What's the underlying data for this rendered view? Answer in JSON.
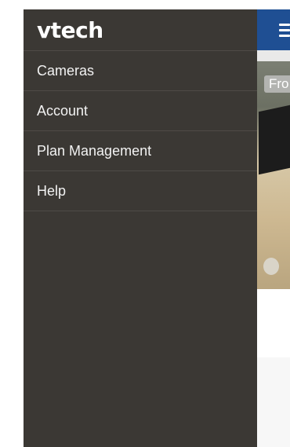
{
  "app": {
    "logo_text": "vtech",
    "header_color": "#1f4f93",
    "drawer_color": "#3b3834"
  },
  "menu": {
    "items": [
      {
        "label": "Cameras"
      },
      {
        "label": "Account"
      },
      {
        "label": "Plan Management"
      },
      {
        "label": "Help"
      }
    ]
  },
  "camera": {
    "label": "Fro"
  },
  "icons": {
    "menu": "hamburger-menu-icon"
  }
}
